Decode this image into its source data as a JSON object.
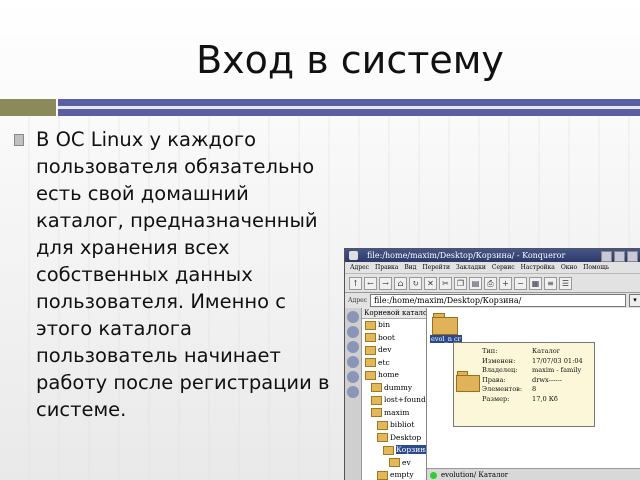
{
  "slide": {
    "title": "Вход в систему",
    "bullet": "В ОС Linux у каждого пользователя обязательно есть свой домашний каталог, предназначенный для хранения всех собственных данных пользователя. Именно с этого каталога пользователь начинает работу после регистрации в системе."
  },
  "konqueror": {
    "window_title": "file:/home/maxim/Desktop/Корзина/ - Konqueror",
    "menu": [
      "Адрес",
      "Правка",
      "Вид",
      "Перейти",
      "Закладки",
      "Сервис",
      "Настройка",
      "Окно",
      "Помощь"
    ],
    "address_label": "Адрес",
    "address_value": "file:/home/maxim/Desktop/Корзина/",
    "tree_header": "Корневой каталог",
    "tree": [
      "bin",
      "boot",
      "dev",
      "etc",
      "home",
      "dummy",
      "lost+found",
      "maxim",
      "bibliot",
      "Desktop",
      "Корзина",
      "ev",
      "empty"
    ],
    "tree_selected_index": 10,
    "folder_label": "evol_n cr",
    "tooltip": [
      {
        "key": "Тип:",
        "value": "Каталог"
      },
      {
        "key": "Изменен:",
        "value": "17/07/03 01:04"
      },
      {
        "key": "Владелец:",
        "value": "maxim - family"
      },
      {
        "key": "Права:",
        "value": "drwx------"
      },
      {
        "key": "Элементов:",
        "value": "8"
      },
      {
        "key": "Размер:",
        "value": "17,0 Кб"
      }
    ],
    "status": "evolution/  Каталог"
  }
}
